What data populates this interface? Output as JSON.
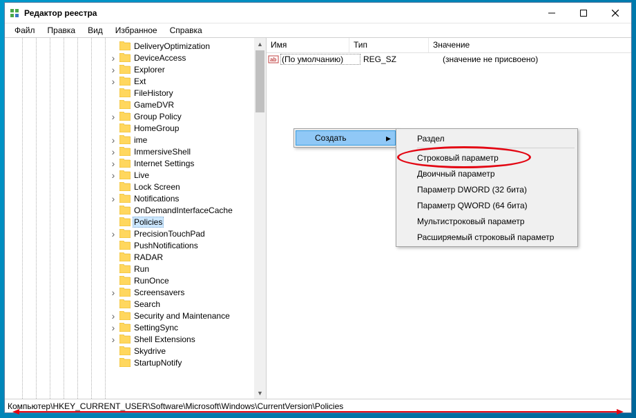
{
  "window": {
    "title": "Редактор реестра"
  },
  "menus": {
    "file": "Файл",
    "edit": "Правка",
    "view": "Вид",
    "favorites": "Избранное",
    "help": "Справка"
  },
  "tree": {
    "nodes": [
      {
        "label": "DeliveryOptimization",
        "exp": "",
        "sel": false
      },
      {
        "label": "DeviceAccess",
        "exp": ">",
        "sel": false
      },
      {
        "label": "Explorer",
        "exp": ">",
        "sel": false
      },
      {
        "label": "Ext",
        "exp": ">",
        "sel": false
      },
      {
        "label": "FileHistory",
        "exp": "",
        "sel": false
      },
      {
        "label": "GameDVR",
        "exp": "",
        "sel": false
      },
      {
        "label": "Group Policy",
        "exp": ">",
        "sel": false
      },
      {
        "label": "HomeGroup",
        "exp": "",
        "sel": false
      },
      {
        "label": "ime",
        "exp": ">",
        "sel": false
      },
      {
        "label": "ImmersiveShell",
        "exp": ">",
        "sel": false
      },
      {
        "label": "Internet Settings",
        "exp": ">",
        "sel": false
      },
      {
        "label": "Live",
        "exp": ">",
        "sel": false
      },
      {
        "label": "Lock Screen",
        "exp": "",
        "sel": false
      },
      {
        "label": "Notifications",
        "exp": ">",
        "sel": false
      },
      {
        "label": "OnDemandInterfaceCache",
        "exp": "",
        "sel": false
      },
      {
        "label": "Policies",
        "exp": "",
        "sel": true
      },
      {
        "label": "PrecisionTouchPad",
        "exp": ">",
        "sel": false
      },
      {
        "label": "PushNotifications",
        "exp": "",
        "sel": false
      },
      {
        "label": "RADAR",
        "exp": "",
        "sel": false
      },
      {
        "label": "Run",
        "exp": "",
        "sel": false
      },
      {
        "label": "RunOnce",
        "exp": "",
        "sel": false
      },
      {
        "label": "Screensavers",
        "exp": ">",
        "sel": false
      },
      {
        "label": "Search",
        "exp": "",
        "sel": false
      },
      {
        "label": "Security and Maintenance",
        "exp": ">",
        "sel": false
      },
      {
        "label": "SettingSync",
        "exp": ">",
        "sel": false
      },
      {
        "label": "Shell Extensions",
        "exp": ">",
        "sel": false
      },
      {
        "label": "Skydrive",
        "exp": "",
        "sel": false
      },
      {
        "label": "StartupNotify",
        "exp": "",
        "sel": false
      }
    ]
  },
  "list": {
    "columns": {
      "name": "Имя",
      "type": "Тип",
      "value": "Значение"
    },
    "rows": [
      {
        "name": "(По умолчанию)",
        "type": "REG_SZ",
        "value": "(значение не присвоено)"
      }
    ]
  },
  "context": {
    "create": "Создать",
    "sub": {
      "key": "Раздел",
      "string": "Строковый параметр",
      "binary": "Двоичный параметр",
      "dword": "Параметр DWORD (32 бита)",
      "qword": "Параметр QWORD (64 бита)",
      "multi": "Мультистроковый параметр",
      "expand": "Расширяемый строковый параметр"
    }
  },
  "statusbar": {
    "path": "Компьютер\\HKEY_CURRENT_USER\\Software\\Microsoft\\Windows\\CurrentVersion\\Policies"
  }
}
